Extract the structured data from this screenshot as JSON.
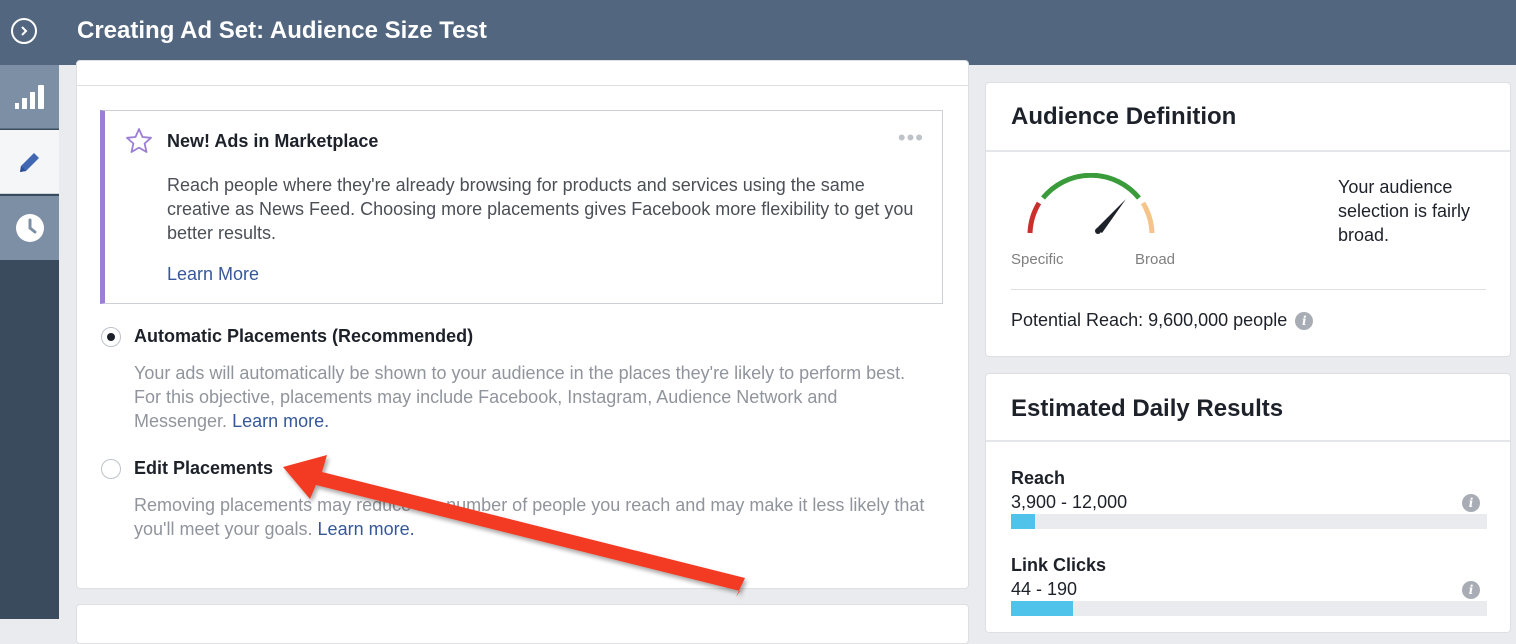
{
  "header": {
    "title": "Creating Ad Set: Audience Size Test"
  },
  "left_rail": {
    "items": [
      {
        "icon": "bar-chart-icon"
      },
      {
        "icon": "pencil-icon"
      },
      {
        "icon": "clock-icon"
      }
    ]
  },
  "notice": {
    "title": "New! Ads in Marketplace",
    "body": "Reach people where they're already browsing for products and services using the same creative as News Feed. Choosing more placements gives Facebook more flexibility to get you better results.",
    "link": "Learn More"
  },
  "placements": {
    "automatic": {
      "label": "Automatic Placements (Recommended)",
      "description": "Your ads will automatically be shown to your audience in the places they're likely to perform best. For this objective, placements may include Facebook, Instagram, Audience Network and Messenger.",
      "link": "Learn more.",
      "selected": true
    },
    "edit": {
      "label": "Edit Placements",
      "description": "Removing placements may reduce the number of people you reach and may make it less likely that you'll meet your goals.",
      "link": "Learn more.",
      "selected": false
    }
  },
  "audience_definition": {
    "title": "Audience Definition",
    "gauge_left": "Specific",
    "gauge_right": "Broad",
    "summary": "Your audience selection is fairly broad.",
    "potential_reach": "Potential Reach: 9,600,000 people"
  },
  "daily_results": {
    "title": "Estimated Daily Results",
    "metrics": [
      {
        "label": "Reach",
        "value": "3,900 - 12,000",
        "fill_fraction": 0.05
      },
      {
        "label": "Link Clicks",
        "value": "44 - 190",
        "fill_fraction": 0.13
      }
    ]
  },
  "colors": {
    "header": "#53667f",
    "accent_bar": "#9b7fd4",
    "link": "#365899",
    "result_bar": "#4fc3ea",
    "arrow": "#f23b22"
  }
}
